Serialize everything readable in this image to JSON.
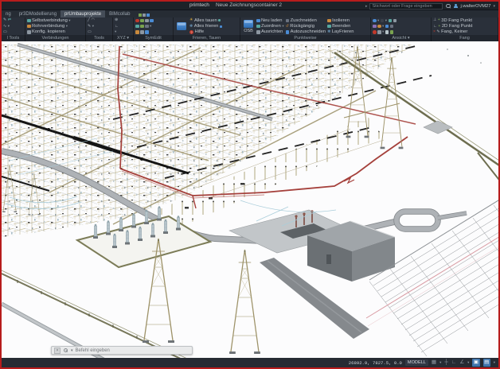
{
  "titlebar": {
    "app": "primtech",
    "doc": "Neue Zeichnungscontainer 2",
    "search_placeholder": "Stichwort oder Frage eingeben",
    "user": "j.walterOVM27"
  },
  "tabs": {
    "t0": "ng",
    "t1": "pr3DModellierung",
    "t2": "prUmbauprojekte",
    "t3": "BIMcollab"
  },
  "ribbon": {
    "g1": {
      "label": "l Tools"
    },
    "g2": {
      "label": "Verbindungen",
      "i1": "Selbstverbindung",
      "i2": "Rohrverbindung",
      "i3": "Konfig. kopieren"
    },
    "g3": {
      "label": "Tools"
    },
    "g4": {
      "label": "XYZ"
    },
    "g5": {
      "label": "SymEdit"
    },
    "g6": {
      "label": "Frieren, Tauen",
      "i1": "Alles tauen",
      "i2": "Alles frieren",
      "i3": "Hilfe"
    },
    "g7": {
      "label": "Punktweise",
      "big": "OSB",
      "i1": "Neu laden",
      "i2": "Zuordnen",
      "i3": "Ausrichten",
      "i4": "Zuschneiden",
      "i5": "Rückgängig",
      "i6": "Autozuschneiden",
      "i7": "Isolieren",
      "i8": "Beenden",
      "i9": "LayFrieren"
    },
    "g8": {
      "label": "Ansicht"
    },
    "g9": {
      "label": "Fang",
      "i1": "3D Fang Punkt",
      "i2": "2D Fang Punkt",
      "i3": "Fang, Keiner"
    }
  },
  "commandline": {
    "placeholder": "Befehl eingeben"
  },
  "statusbar": {
    "coords": "26892.9, 7827.5, 0.0",
    "space": "MODELL"
  },
  "palette": {
    "frame_red": "#b71c1c",
    "ui_dark": "#2a303a",
    "ui_accent_blue": "#3f74ab",
    "steel_tan": "#b0a67c",
    "busbar_black": "#1a1a1a",
    "cable_red": "#a5403b",
    "road_gray": "#aeb2b6",
    "building_gray": "#6f7478",
    "insulator_teal": "#b7c4ca",
    "fence_olive": "#77775a",
    "table_pink": "#d99ba3"
  }
}
